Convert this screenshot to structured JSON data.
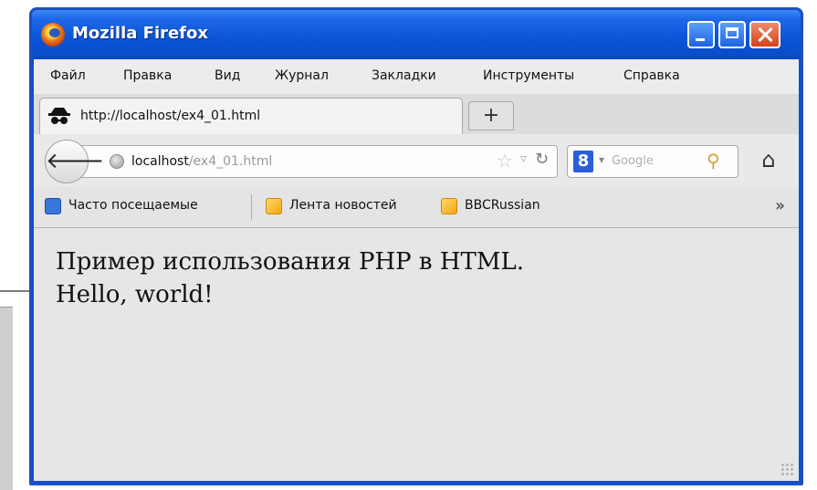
{
  "window": {
    "title": "Mozilla Firefox",
    "icon": "firefox-icon"
  },
  "menu": {
    "items": [
      "Файл",
      "Правка",
      "Вид",
      "Журнал",
      "Закладки",
      "Инструменты",
      "Справка"
    ]
  },
  "tab": {
    "title": "http://localhost/ex4_01.html",
    "icon": "incognito-icon",
    "new_tab_label": "+"
  },
  "navbar": {
    "url_host": "localhost",
    "url_path": "/ex4_01.html",
    "search_placeholder": "Google",
    "search_engine_icon": "google-icon"
  },
  "bookmarks": {
    "items": [
      "Часто посещаемые",
      "Лента новостей",
      "BBCRussian"
    ],
    "overflow": "»"
  },
  "content": {
    "line1": "Пример использования PHP в HTML.",
    "line2": "Hello, world!"
  },
  "colors": {
    "titlebar": "#0a54d6",
    "close_button": "#d4431b",
    "content_background": "#e6e6e6"
  }
}
